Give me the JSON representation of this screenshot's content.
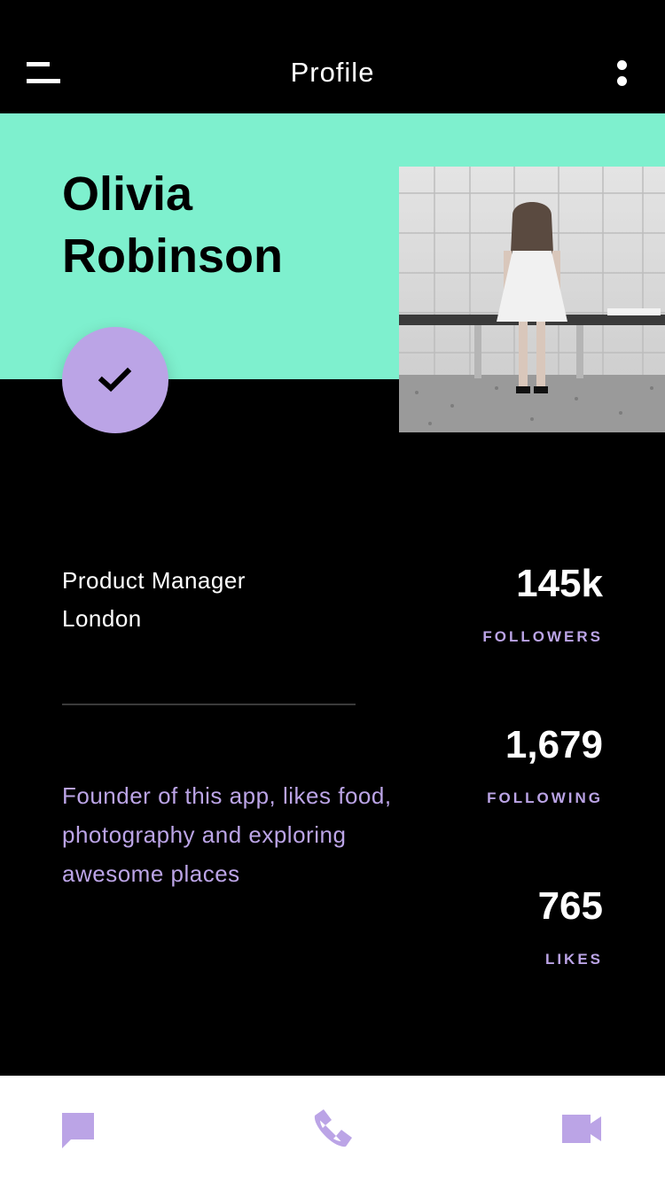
{
  "header": {
    "title": "Profile",
    "menu_icon": "hamburger-menu-icon",
    "more_icon": "more-vertical-icon"
  },
  "profile": {
    "name": "Olivia Robinson",
    "job_title": "Product Manager",
    "location": "London",
    "bio": "Founder of this app, likes food, photography and exploring awesome places",
    "verified_icon": "checkmark-icon",
    "photo": "woman-sitting-on-bench-photo"
  },
  "stats": [
    {
      "value": "145k",
      "label": "FOLLOWERS"
    },
    {
      "value": "1,679",
      "label": "FOLLOWING"
    },
    {
      "value": "765",
      "label": "LIKES"
    }
  ],
  "bottom_nav": [
    {
      "icon": "chat-bubble-icon"
    },
    {
      "icon": "phone-icon"
    },
    {
      "icon": "video-camera-icon"
    }
  ],
  "colors": {
    "background": "#000000",
    "accent_mint": "#7EF0CE",
    "accent_lavender": "#BBA4E6",
    "text_white": "#FFFFFF",
    "nav_background": "#FFFFFF"
  }
}
